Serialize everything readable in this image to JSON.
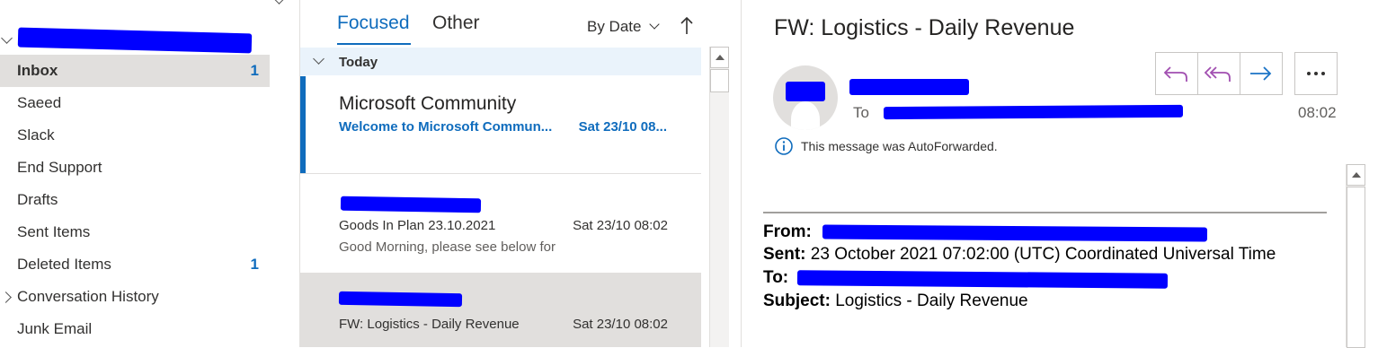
{
  "folders": {
    "items": [
      {
        "label": "Inbox",
        "count": "1"
      },
      {
        "label": "Saeed",
        "count": ""
      },
      {
        "label": "Slack",
        "count": ""
      },
      {
        "label": "End Support",
        "count": ""
      },
      {
        "label": "Drafts",
        "count": ""
      },
      {
        "label": "Sent Items",
        "count": ""
      },
      {
        "label": "Deleted Items",
        "count": "1"
      },
      {
        "label": "Conversation History",
        "count": ""
      },
      {
        "label": "Junk Email",
        "count": ""
      }
    ]
  },
  "message_list": {
    "tabs": {
      "focused": "Focused",
      "other": "Other"
    },
    "sort_label": "By Date",
    "group_header": "Today",
    "messages": [
      {
        "from": "Microsoft Community",
        "subject": "Welcome to Microsoft Commun...",
        "date": "Sat 23/10 08...",
        "preview": ""
      },
      {
        "from": "",
        "subject": "Goods In Plan 23.10.2021",
        "date": "Sat 23/10 08:02",
        "preview": "Good Morning,  please see below for"
      },
      {
        "from": "",
        "subject": "FW: Logistics - Daily Revenue",
        "date": "Sat 23/10 08:02",
        "preview": ""
      }
    ]
  },
  "reading_pane": {
    "title": "FW: Logistics - Daily Revenue",
    "to_label": "To",
    "time": "08:02",
    "autoforward_notice": "This message was AutoForwarded.",
    "header_block": {
      "from_label": "From:",
      "sent_label": "Sent:",
      "sent_value": "23 October 2021 07:02:00 (UTC) Coordinated Universal Time",
      "to_label": "To:",
      "subject_label": "Subject:",
      "subject_value": "Logistics - Daily Revenue"
    }
  },
  "colors": {
    "accent": "#0f6cbd",
    "redaction": "#0000ff",
    "reply_purple": "#a14fb0",
    "forward_blue": "#1a73c6"
  }
}
